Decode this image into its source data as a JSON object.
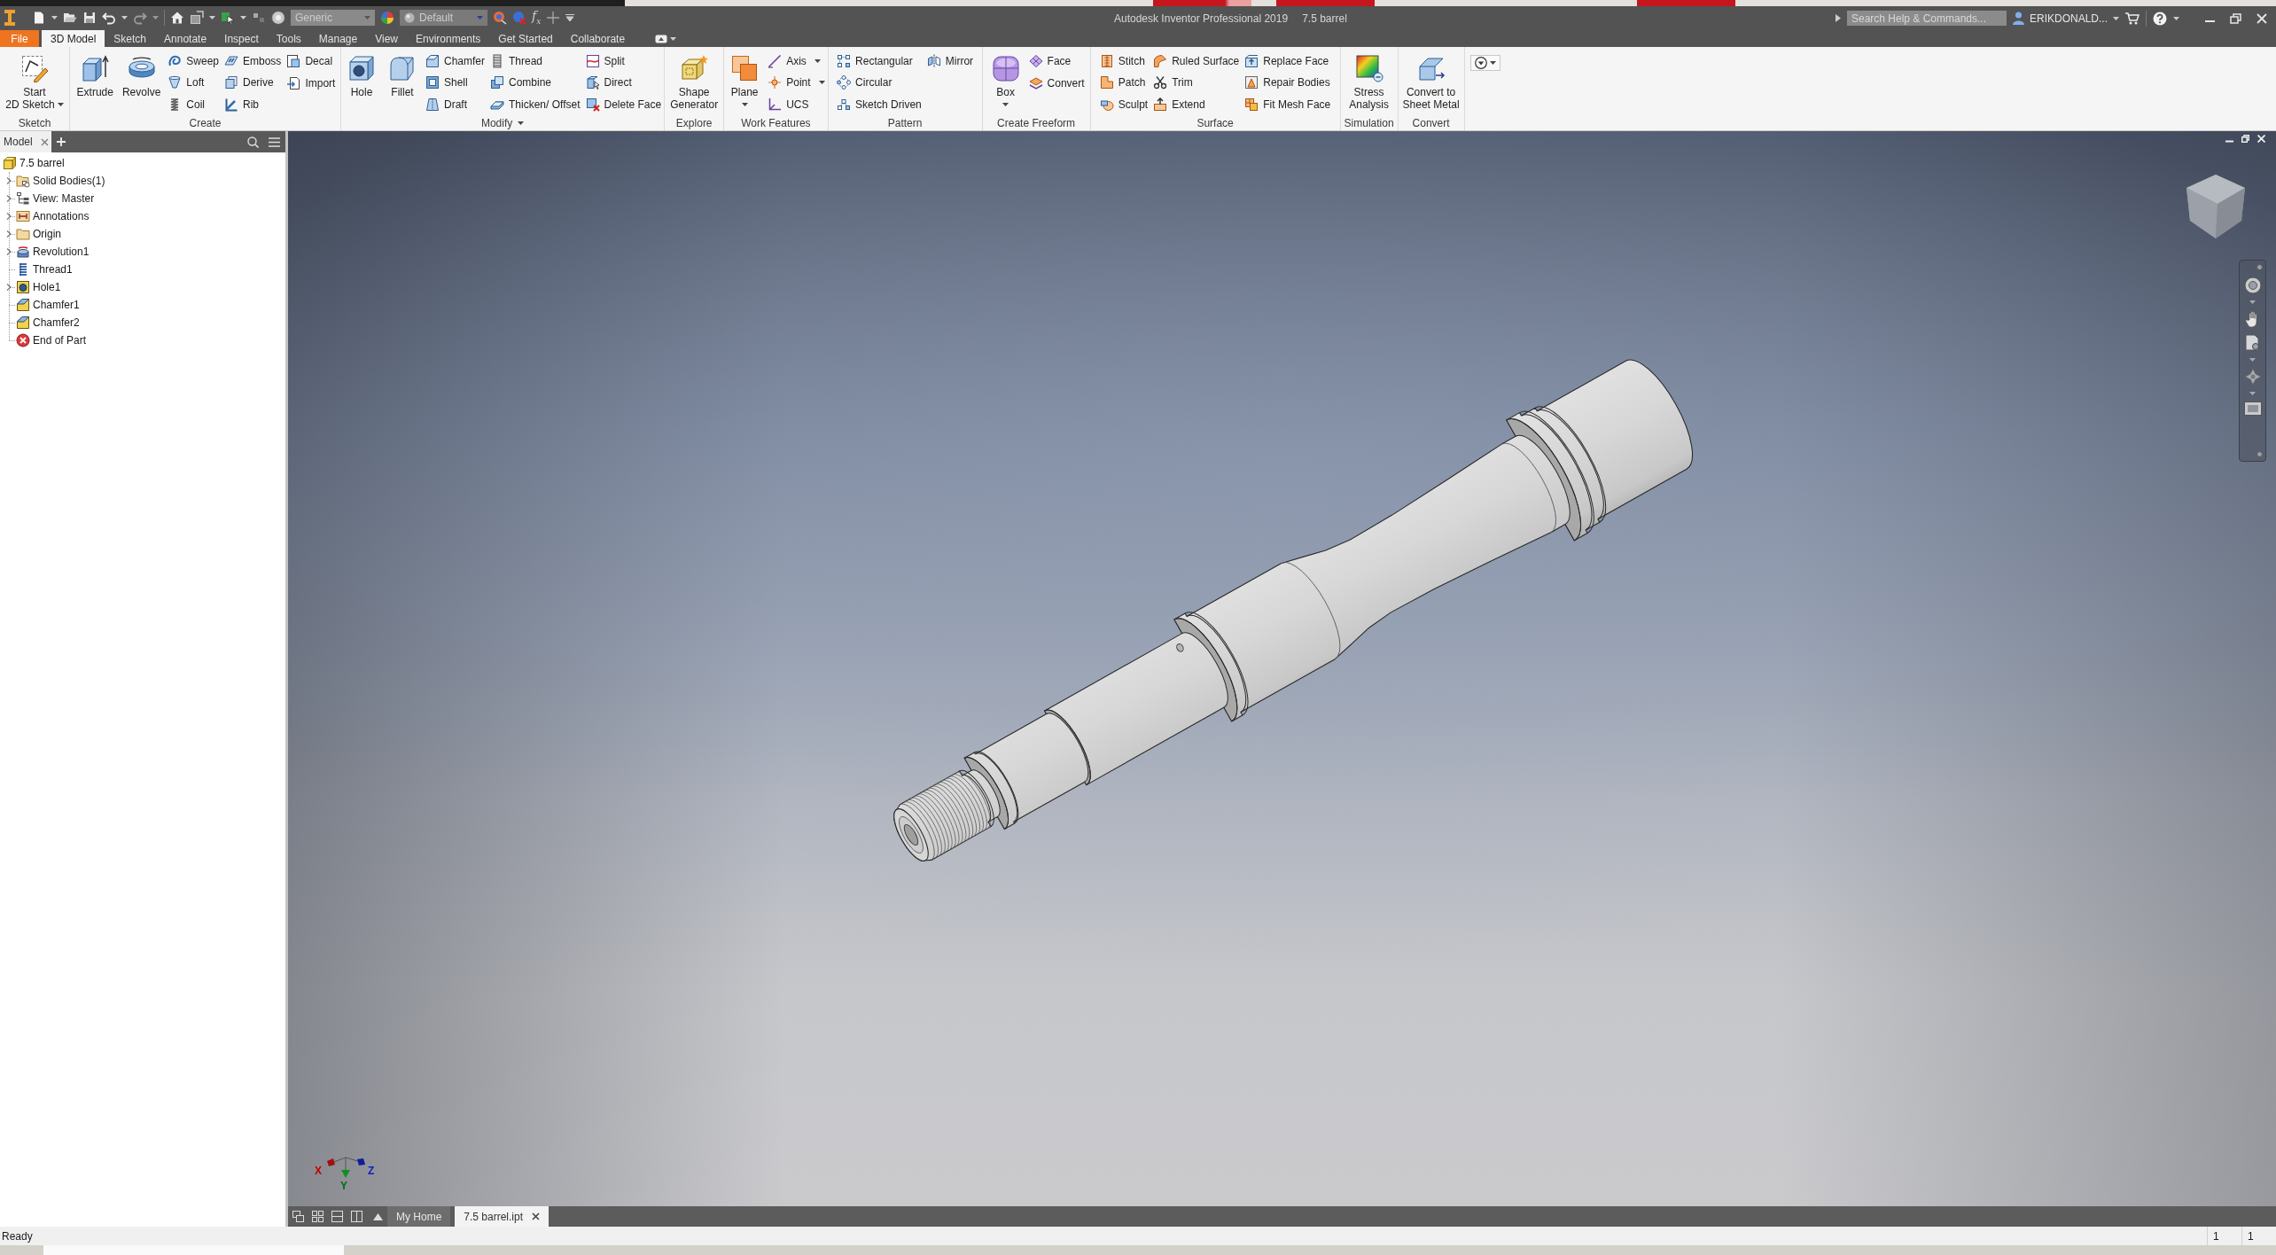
{
  "title_bar": {
    "material": "Generic",
    "appearance": "Default",
    "parameters": "f$_{x}$",
    "title": "Autodesk Inventor Professional 2019",
    "document": "7.5 barrel",
    "search": {
      "placeholder": "Search Help & Commands..."
    },
    "user": "ERIKDONALD..."
  },
  "ribbon_tabs": [
    {
      "label": "File",
      "kind": "file",
      "selected": false
    },
    {
      "label": "3D Model",
      "kind": "tab",
      "selected": true
    },
    {
      "label": "Sketch",
      "kind": "tab",
      "selected": false
    },
    {
      "label": "Annotate",
      "kind": "tab",
      "selected": false
    },
    {
      "label": "Inspect",
      "kind": "tab",
      "selected": false
    },
    {
      "label": "Tools",
      "kind": "tab",
      "selected": false
    },
    {
      "label": "Manage",
      "kind": "tab",
      "selected": false
    },
    {
      "label": "View",
      "kind": "tab",
      "selected": false
    },
    {
      "label": "Environments",
      "kind": "tab",
      "selected": false
    },
    {
      "label": "Get Started",
      "kind": "tab",
      "selected": false
    },
    {
      "label": "Collaborate",
      "kind": "tab",
      "selected": false
    }
  ],
  "ribbon_panels": [
    {
      "label": "Sketch",
      "menu": false,
      "tools": [
        {
          "label": "Start\n2D Sketch",
          "kind": "large",
          "dropdown": true
        }
      ]
    },
    {
      "label": "Create",
      "menu": false,
      "tools": [
        {
          "label": "Extrude",
          "kind": "large",
          "dropdown": false
        },
        {
          "label": "Revolve",
          "kind": "large",
          "dropdown": false
        },
        {
          "label": "Sweep",
          "kind": "small",
          "dropdown": false
        },
        {
          "label": "Loft",
          "kind": "small",
          "dropdown": false
        },
        {
          "label": "Coil",
          "kind": "small",
          "dropdown": false
        },
        {
          "label": "Emboss",
          "kind": "small",
          "dropdown": false
        },
        {
          "label": "Derive",
          "kind": "small",
          "dropdown": false
        },
        {
          "label": "Rib",
          "kind": "small",
          "dropdown": false
        },
        {
          "label": "Decal",
          "kind": "small",
          "dropdown": false
        },
        {
          "label": "Import",
          "kind": "small",
          "dropdown": false
        }
      ]
    },
    {
      "label": "Modify",
      "menu": true,
      "tools": [
        {
          "label": "Hole",
          "kind": "large",
          "dropdown": false
        },
        {
          "label": "Fillet",
          "kind": "large",
          "dropdown": false
        },
        {
          "label": "Chamfer",
          "kind": "small",
          "dropdown": false
        },
        {
          "label": "Shell",
          "kind": "small",
          "dropdown": false
        },
        {
          "label": "Draft",
          "kind": "small",
          "dropdown": false
        },
        {
          "label": "Thread",
          "kind": "small",
          "dropdown": false
        },
        {
          "label": "Combine",
          "kind": "small",
          "dropdown": false
        },
        {
          "label": "Thicken/ Offset",
          "kind": "small",
          "dropdown": false
        },
        {
          "label": "Split",
          "kind": "small",
          "dropdown": false
        },
        {
          "label": "Direct",
          "kind": "small",
          "dropdown": false
        },
        {
          "label": "Delete Face",
          "kind": "small",
          "dropdown": false
        }
      ]
    },
    {
      "label": "Explore",
      "menu": false,
      "tools": [
        {
          "label": "Shape\nGenerator",
          "kind": "large",
          "dropdown": false
        }
      ]
    },
    {
      "label": "Work Features",
      "menu": false,
      "tools": [
        {
          "label": "Plane",
          "kind": "large",
          "dropdown": true
        },
        {
          "label": "Axis",
          "kind": "small",
          "dropdown": true
        },
        {
          "label": "Point",
          "kind": "small",
          "dropdown": true
        },
        {
          "label": "UCS",
          "kind": "small",
          "dropdown": false
        }
      ]
    },
    {
      "label": "Pattern",
      "menu": false,
      "tools": [
        {
          "label": "Rectangular",
          "kind": "small",
          "dropdown": false
        },
        {
          "label": "Circular",
          "kind": "small",
          "dropdown": false
        },
        {
          "label": "Sketch Driven",
          "kind": "small",
          "dropdown": false
        },
        {
          "label": "Mirror",
          "kind": "small",
          "dropdown": false
        }
      ]
    },
    {
      "label": "Create Freeform",
      "menu": false,
      "tools": [
        {
          "label": "Box",
          "kind": "large",
          "dropdown": true
        },
        {
          "label": "Face",
          "kind": "small",
          "dropdown": false
        },
        {
          "label": "Convert",
          "kind": "small",
          "dropdown": false
        }
      ]
    },
    {
      "label": "Surface",
      "menu": false,
      "tools": [
        {
          "label": "Stitch",
          "kind": "small",
          "dropdown": false
        },
        {
          "label": "Patch",
          "kind": "small",
          "dropdown": false
        },
        {
          "label": "Sculpt",
          "kind": "small",
          "dropdown": false
        },
        {
          "label": "Ruled Surface",
          "kind": "small",
          "dropdown": false
        },
        {
          "label": "Trim",
          "kind": "small",
          "dropdown": false
        },
        {
          "label": "Extend",
          "kind": "small",
          "dropdown": false
        },
        {
          "label": "Replace Face",
          "kind": "small",
          "dropdown": false
        },
        {
          "label": "Repair Bodies",
          "kind": "small",
          "dropdown": false
        },
        {
          "label": "Fit Mesh Face",
          "kind": "small",
          "dropdown": false
        }
      ]
    },
    {
      "label": "Simulation",
      "menu": false,
      "tools": [
        {
          "label": "Stress\nAnalysis",
          "kind": "large",
          "dropdown": false
        }
      ]
    },
    {
      "label": "Convert",
      "menu": false,
      "tools": [
        {
          "label": "Convert to\nSheet Metal",
          "kind": "large",
          "dropdown": false
        }
      ]
    }
  ],
  "browser": {
    "tabs": [
      {
        "label": "Model",
        "selected": true
      }
    ],
    "tree": {
      "label": "7.5 barrel",
      "kind": "part",
      "collapsed": false,
      "children": [
        {
          "label": "Solid Bodies(1)",
          "kind": "bodies",
          "collapsed": true
        },
        {
          "label": "View: Master",
          "kind": "view",
          "collapsed": true
        },
        {
          "label": "Annotations",
          "kind": "annotations",
          "collapsed": true
        },
        {
          "label": "Origin",
          "kind": "folder",
          "collapsed": true
        },
        {
          "label": "Revolution1",
          "kind": "revolve",
          "collapsed": true
        },
        {
          "label": "Thread1",
          "kind": "thread",
          "collapsed": false
        },
        {
          "label": "Hole1",
          "kind": "hole",
          "collapsed": true
        },
        {
          "label": "Chamfer1",
          "kind": "chamfer",
          "collapsed": false
        },
        {
          "label": "Chamfer2",
          "kind": "chamfer",
          "collapsed": false
        },
        {
          "label": "End of Part",
          "kind": "end",
          "collapsed": false
        }
      ]
    }
  },
  "viewport": {
    "triad": [
      {
        "label": "X",
        "color": "#c00000"
      },
      {
        "label": "Y",
        "color": "#006e10"
      },
      {
        "label": "Z",
        "color": "#1020c8"
      }
    ]
  },
  "document_tabs": [
    {
      "label": "My Home",
      "selected": false
    },
    {
      "label": "7.5 barrel.ipt",
      "selected": true
    }
  ],
  "status_bar": {
    "message": "Ready",
    "counters": [
      "1",
      "1"
    ]
  }
}
